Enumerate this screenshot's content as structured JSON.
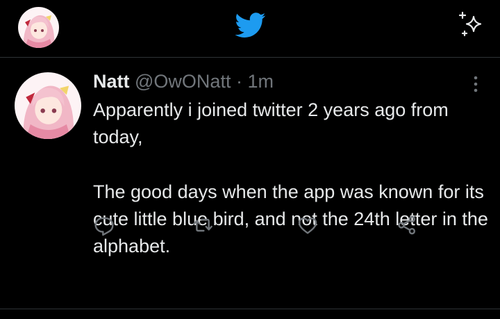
{
  "topbar": {
    "profile_avatar_icon": "anime-avatar-icon",
    "logo_icon": "twitter-bird-icon",
    "sparkle_icon": "sparkle-icon"
  },
  "tweet": {
    "author_name": "Natt",
    "handle": "@OwONatt",
    "separator": "·",
    "time": "1m",
    "paragraphs": [
      "Apparently i joined twitter 2 years ago from today,",
      "The good days when the app was known for its cute little blue bird, and not the 24th letter in the alphabet."
    ],
    "actions": [
      "reply-icon",
      "retweet-icon",
      "like-icon",
      "share-icon"
    ]
  },
  "colors": {
    "background": "#000000",
    "text": "#e7e9ea",
    "muted": "#71767b",
    "accent": "#1d9bf0",
    "divider": "#2f3336"
  }
}
